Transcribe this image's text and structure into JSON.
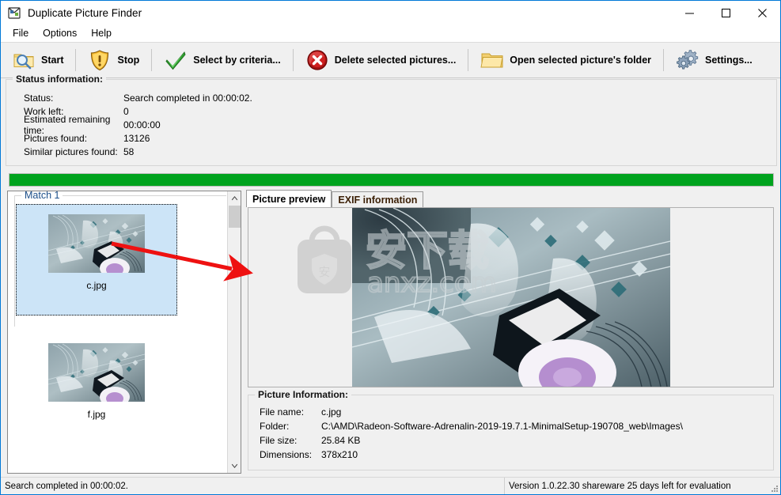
{
  "window": {
    "title": "Duplicate Picture Finder",
    "icon": "app-icon",
    "controls": {
      "minimize": "—",
      "maximize": "□",
      "close": "✕"
    }
  },
  "menubar": {
    "items": [
      {
        "label": "File"
      },
      {
        "label": "Options"
      },
      {
        "label": "Help"
      }
    ]
  },
  "toolbar": {
    "buttons": [
      {
        "label": "Start",
        "icon": "search-folder-icon"
      },
      {
        "label": "Stop",
        "icon": "warning-shield-icon"
      },
      {
        "label": "Select by criteria...",
        "icon": "green-check-icon"
      },
      {
        "label": "Delete selected pictures...",
        "icon": "red-x-circle-icon"
      },
      {
        "label": "Open selected picture's folder",
        "icon": "folder-icon"
      },
      {
        "label": "Settings...",
        "icon": "gears-icon"
      }
    ]
  },
  "status_information": {
    "title": "Status information:",
    "rows": [
      {
        "label": "Status:",
        "value": "Search completed in 00:00:02."
      },
      {
        "label": "Work left:",
        "value": "0"
      },
      {
        "label": "Estimated remaining time:",
        "value": "00:00:00"
      },
      {
        "label": "Pictures found:",
        "value": "13126"
      },
      {
        "label": "Similar pictures found:",
        "value": "58"
      }
    ]
  },
  "progress": {
    "percent": 100,
    "color": "#00a31e"
  },
  "matches_panel": {
    "groups": [
      {
        "title": "Match 1",
        "items": [
          {
            "name": "c.jpg",
            "selected": true
          },
          {
            "name": "f.jpg",
            "selected": false
          }
        ]
      }
    ],
    "scrollbar": {
      "up_arrow": "⌃",
      "down_arrow": "⌄"
    }
  },
  "preview": {
    "tabs": [
      {
        "label": "Picture preview",
        "active": true
      },
      {
        "label": "EXIF information",
        "active": false
      }
    ],
    "watermark": {
      "text": "anxz.com",
      "cjk": "安下载",
      "badge_char": "安"
    }
  },
  "picture_information": {
    "title": "Picture Information:",
    "rows": [
      {
        "label": "File name:",
        "value": "c.jpg"
      },
      {
        "label": "Folder:",
        "value": "C:\\AMD\\Radeon-Software-Adrenalin-2019-19.7.1-MinimalSetup-190708_web\\Images\\"
      },
      {
        "label": "File size:",
        "value": "25.84 KB"
      },
      {
        "label": "Dimensions:",
        "value": "378x210"
      }
    ]
  },
  "statusbar": {
    "left": "Search completed in 00:00:02.",
    "right": "Version 1.0.22.30 shareware 25 days left for evaluation"
  }
}
